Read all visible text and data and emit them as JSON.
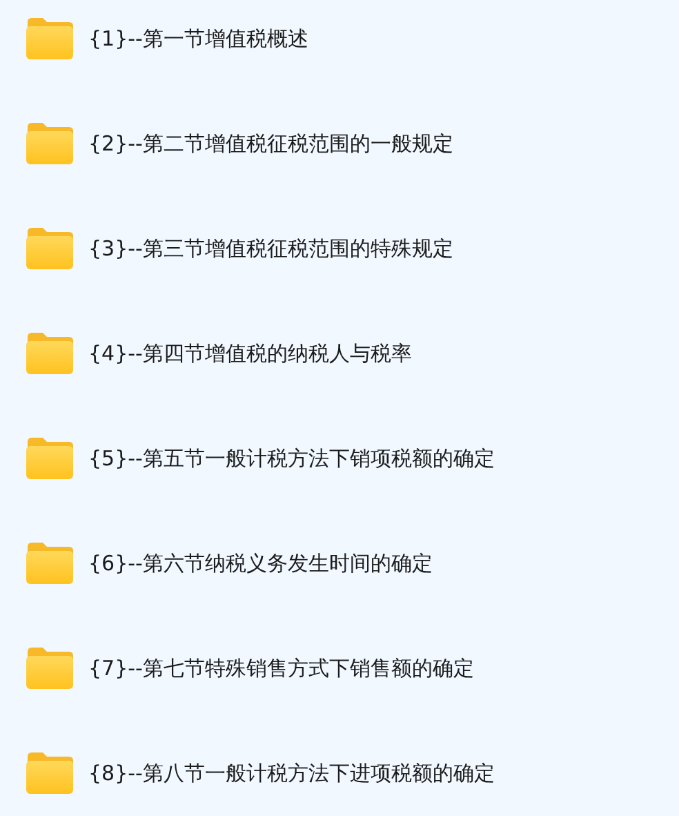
{
  "folders": [
    {
      "label": "{1}--第一节增值税概述"
    },
    {
      "label": "{2}--第二节增值税征税范围的一般规定"
    },
    {
      "label": "{3}--第三节增值税征税范围的特殊规定"
    },
    {
      "label": "{4}--第四节增值税的纳税人与税率"
    },
    {
      "label": "{5}--第五节一般计税方法下销项税额的确定"
    },
    {
      "label": "{6}--第六节纳税义务发生时间的确定"
    },
    {
      "label": "{7}--第七节特殊销售方式下销售额的确定"
    },
    {
      "label": "{8}--第八节一般计税方法下进项税额的确定"
    }
  ]
}
